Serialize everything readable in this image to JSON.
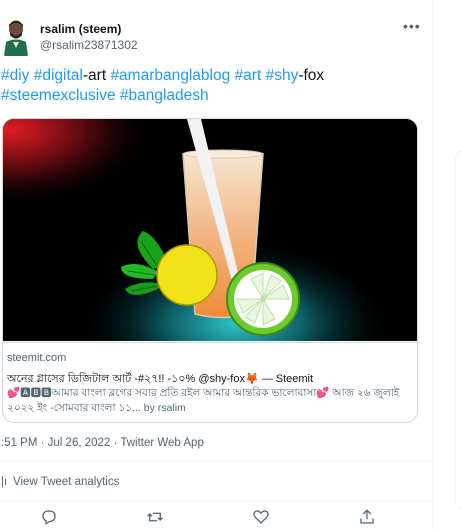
{
  "tweet": {
    "author": {
      "name": "rsalim (steem)",
      "handle": "@rsalim23871302"
    },
    "text": [
      {
        "type": "tag",
        "value": "#diy"
      },
      {
        "type": "text",
        "value": " "
      },
      {
        "type": "tag",
        "value": "#digital"
      },
      {
        "type": "text",
        "value": "-art "
      },
      {
        "type": "tag",
        "value": "#amarbanglablog"
      },
      {
        "type": "text",
        "value": " "
      },
      {
        "type": "tag",
        "value": "#art"
      },
      {
        "type": "text",
        "value": " "
      },
      {
        "type": "tag",
        "value": "#shy"
      },
      {
        "type": "text",
        "value": "-fox "
      },
      {
        "type": "tag",
        "value": "#steemexclusive"
      },
      {
        "type": "text",
        "value": " "
      },
      {
        "type": "tag",
        "value": "#bangladesh"
      }
    ],
    "card": {
      "domain": "steemit.com",
      "title": "অনের গ্লাসের ডিজিটাল আর্ট -#২৭!! -১০% @shy-fox🦊 — Steemit",
      "description_badge": "🅰🅱🅱",
      "description_a": "আমার বাংলা ব্লগের সবার প্রতি রইল আমার আন্তরিক ভালোবাসা",
      "description_b": "আজ ২৬ জুলাই ২০২২ ইং -সোমবার বাংলা ১১... by rsalim"
    },
    "meta": ":51 PM · Jul 26, 2022 · Twitter Web App",
    "analytics_label": "View Tweet analytics"
  },
  "colors": {
    "link": "#1d9bf0",
    "muted": "#536471",
    "border": "#cfd9de"
  },
  "icons": [
    "more-icon",
    "reply-icon",
    "retweet-icon",
    "like-icon",
    "share-icon",
    "analytics-icon"
  ]
}
